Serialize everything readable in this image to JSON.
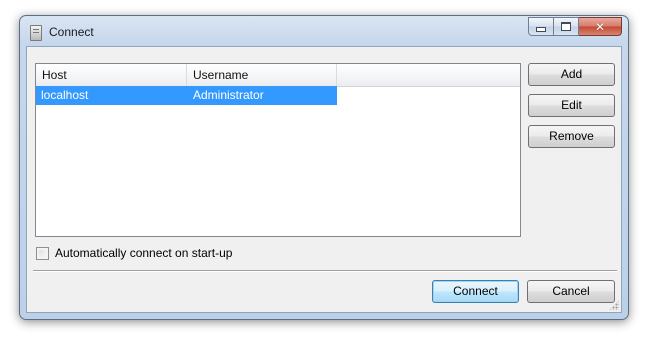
{
  "window": {
    "title": "Connect",
    "icon": "document-icon",
    "caption_buttons": [
      "minimize-icon",
      "maximize-icon",
      "close-icon"
    ]
  },
  "list": {
    "columns": [
      "Host",
      "Username",
      ""
    ],
    "rows": [
      {
        "host": "localhost",
        "username": "Administrator",
        "selected": true
      }
    ]
  },
  "side_buttons": {
    "add": "Add",
    "edit": "Edit",
    "remove": "Remove"
  },
  "auto_connect": {
    "label": "Automatically connect on start-up",
    "checked": false
  },
  "footer": {
    "connect": "Connect",
    "cancel": "Cancel"
  },
  "colors": {
    "selection": "#3399ff",
    "dialog_bg": "#f0f0f0",
    "title_bar": "#c6d7ec",
    "close_button": "#c24a36"
  }
}
